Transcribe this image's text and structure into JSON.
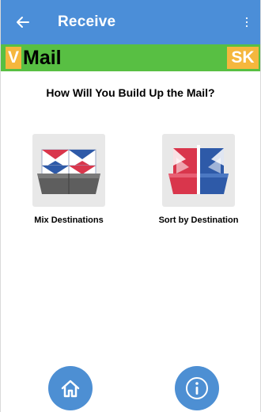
{
  "app_bar": {
    "title": "Receive",
    "back_icon": "arrow-left-icon",
    "menu_icon": "overflow-menu-icon",
    "background_color": "#4b8ed8"
  },
  "brand": {
    "logo_v": "V",
    "logo_mail": "Mail",
    "logo_sk": "SK",
    "bar_color": "#58bf43",
    "badge_color": "#f5b73d"
  },
  "main": {
    "question": "How Will You Build Up the Mail?",
    "options": [
      {
        "label": "Mix Destinations",
        "icon": "mixed-mail-tray-icon"
      },
      {
        "label": "Sort by Destination",
        "icon": "sorted-mail-tray-icon"
      }
    ]
  },
  "bottom_nav": {
    "home_icon": "home-icon",
    "info_icon": "info-icon",
    "button_color": "#4d8fd3"
  }
}
